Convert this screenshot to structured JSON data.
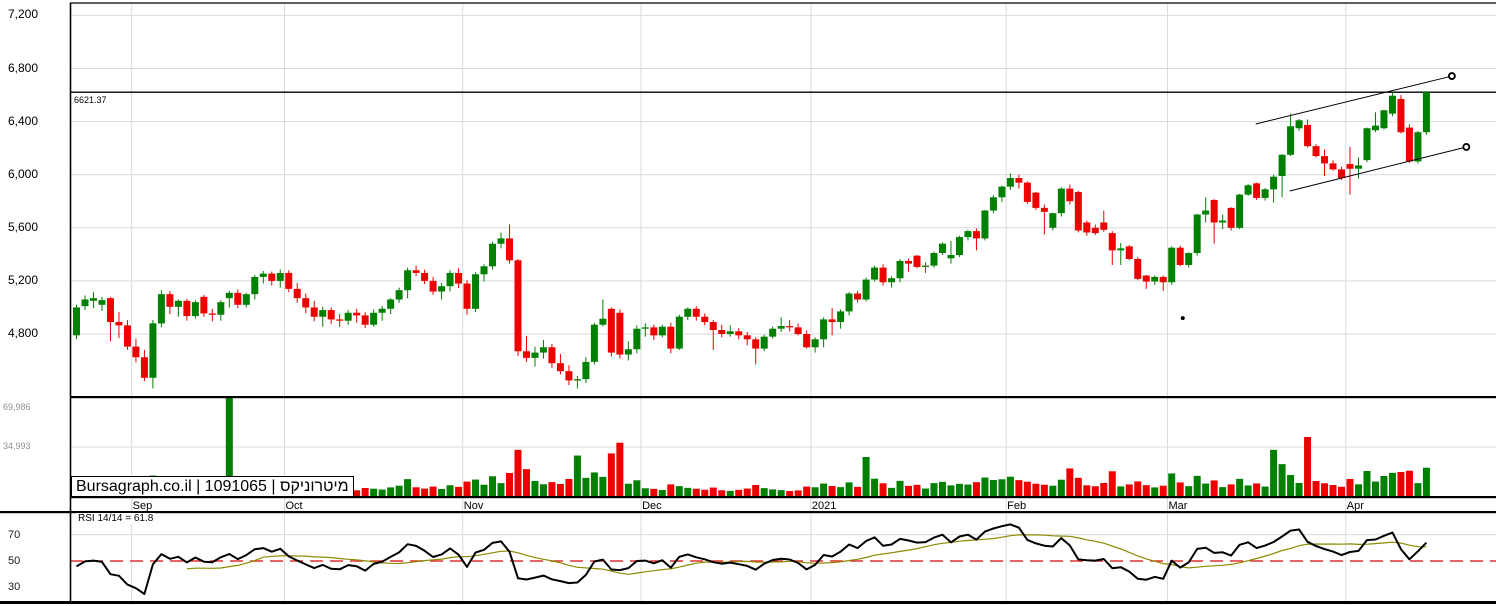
{
  "meta": {
    "source": "Bursagraph.co.il",
    "security_id": "1091065",
    "security_name": "מיטרוניקס",
    "watermark": "Bursagraph.co.il | 1091065 | מיטרוניקס"
  },
  "last_price": {
    "label": "6621.37",
    "value": 6621.37
  },
  "rsi_panel": {
    "label": "RSI 14/14 = 61.8",
    "period": 14,
    "smoothing": 14,
    "last_value": 61.8,
    "ticks": [
      {
        "label": "70",
        "value": 70,
        "gridline": "gray"
      },
      {
        "label": "50",
        "value": 50,
        "gridline": "dashed-red"
      },
      {
        "label": "30",
        "value": 30,
        "gridline": "none"
      }
    ]
  },
  "price_axis": {
    "ticks": [
      {
        "label": "7,200",
        "value": 7200
      },
      {
        "label": "6,800",
        "value": 6800
      },
      {
        "label": "6,400",
        "value": 6400
      },
      {
        "label": "6,000",
        "value": 6000
      },
      {
        "label": "5,600",
        "value": 5600
      },
      {
        "label": "5,200",
        "value": 5200
      },
      {
        "label": "4,800",
        "value": 4800
      }
    ]
  },
  "volume_axis": {
    "ticks": [
      {
        "label": "69,986",
        "value": 69986
      },
      {
        "label": "34,993",
        "value": 34993
      }
    ]
  },
  "colors": {
    "up": "#008000",
    "down": "#ee0000",
    "grid": "#d9d9d9",
    "border": "#000000",
    "rsi_line": "#000000",
    "rsi_signal": "#8a8a00",
    "rsi_midline": "#e03030",
    "last_price_line": "#000000",
    "volume_label": "#8f8f8f"
  },
  "chart_data": {
    "type": "candlestick",
    "panels": [
      "price",
      "volume",
      "rsi"
    ],
    "price_ylim": [
      4330,
      7290
    ],
    "volume_ylim": [
      0,
      69986
    ],
    "rsi_ylim": [
      15,
      88
    ],
    "grid": true,
    "months": [
      {
        "label": "Sep",
        "boundary_index": 7
      },
      {
        "label": "Oct",
        "boundary_index": 25
      },
      {
        "label": "Nov",
        "boundary_index": 46
      },
      {
        "label": "Dec",
        "boundary_index": 67
      },
      {
        "label": "2021",
        "boundary_index": 87
      },
      {
        "label": "Feb",
        "boundary_index": 110
      },
      {
        "label": "Mar",
        "boundary_index": 129
      },
      {
        "label": "Apr",
        "boundary_index": 150
      }
    ],
    "ohlcv_format": [
      "open",
      "high",
      "low",
      "close",
      "volume"
    ],
    "candles": [
      [
        4790,
        5020,
        4760,
        5000,
        9000
      ],
      [
        5010,
        5090,
        4980,
        5060,
        6000
      ],
      [
        5050,
        5115,
        4995,
        5070,
        5500
      ],
      [
        5020,
        5080,
        4975,
        5055,
        5000
      ],
      [
        5070,
        5080,
        4745,
        4890,
        12000
      ],
      [
        4890,
        4965,
        4770,
        4865,
        7000
      ],
      [
        4865,
        4905,
        4680,
        4705,
        9500
      ],
      [
        4705,
        4765,
        4585,
        4625,
        8000
      ],
      [
        4625,
        4680,
        4445,
        4470,
        10000
      ],
      [
        4470,
        4905,
        4390,
        4880,
        15000
      ],
      [
        4880,
        5130,
        4850,
        5100,
        11000
      ],
      [
        5100,
        5125,
        4950,
        5005,
        8500
      ],
      [
        5005,
        5060,
        4930,
        5050,
        5200
      ],
      [
        5050,
        5065,
        4900,
        4935,
        6800
      ],
      [
        4935,
        5055,
        4915,
        5040,
        6200
      ],
      [
        5080,
        5095,
        4930,
        4955,
        7400
      ],
      [
        4955,
        4990,
        4895,
        4945,
        4800
      ],
      [
        4945,
        5055,
        4900,
        5040,
        6600
      ],
      [
        5070,
        5125,
        5000,
        5110,
        69986
      ],
      [
        5110,
        5135,
        4995,
        5020,
        9800
      ],
      [
        5020,
        5110,
        5000,
        5100,
        7200
      ],
      [
        5100,
        5245,
        5060,
        5230,
        10500
      ],
      [
        5230,
        5275,
        5180,
        5255,
        6400
      ],
      [
        5255,
        5270,
        5165,
        5200,
        5600
      ],
      [
        5200,
        5285,
        5150,
        5260,
        7800
      ],
      [
        5260,
        5280,
        5115,
        5140,
        9200
      ],
      [
        5140,
        5185,
        5035,
        5070,
        7600
      ],
      [
        5070,
        5105,
        4955,
        5000,
        6900
      ],
      [
        5000,
        5050,
        4895,
        4930,
        8100
      ],
      [
        4930,
        5005,
        4855,
        4980,
        5400
      ],
      [
        4980,
        5000,
        4875,
        4910,
        4900
      ],
      [
        4910,
        4950,
        4855,
        4900,
        4300
      ],
      [
        4900,
        4980,
        4870,
        4960,
        5100
      ],
      [
        4960,
        4990,
        4885,
        4940,
        4700
      ],
      [
        4940,
        4965,
        4845,
        4870,
        6300
      ],
      [
        4870,
        4985,
        4855,
        4960,
        5800
      ],
      [
        4960,
        5010,
        4900,
        4990,
        5200
      ],
      [
        4990,
        5070,
        4950,
        5060,
        6700
      ],
      [
        5060,
        5150,
        5035,
        5130,
        7900
      ],
      [
        5130,
        5300,
        5070,
        5280,
        12500
      ],
      [
        5280,
        5315,
        5235,
        5260,
        6800
      ],
      [
        5260,
        5285,
        5175,
        5200,
        5900
      ],
      [
        5200,
        5230,
        5095,
        5120,
        7300
      ],
      [
        5120,
        5185,
        5060,
        5160,
        5600
      ],
      [
        5160,
        5280,
        5120,
        5260,
        8200
      ],
      [
        5260,
        5295,
        5145,
        5180,
        7100
      ],
      [
        5180,
        5205,
        4945,
        4990,
        10800
      ],
      [
        4990,
        5265,
        4965,
        5250,
        12200
      ],
      [
        5250,
        5325,
        5195,
        5310,
        8600
      ],
      [
        5310,
        5495,
        5285,
        5480,
        14500
      ],
      [
        5480,
        5565,
        5445,
        5520,
        9700
      ],
      [
        5520,
        5625,
        5330,
        5355,
        16800
      ],
      [
        5355,
        5365,
        4635,
        4670,
        33000
      ],
      [
        4670,
        4785,
        4590,
        4620,
        19500
      ],
      [
        4620,
        4705,
        4555,
        4660,
        11200
      ],
      [
        4660,
        4755,
        4615,
        4700,
        8900
      ],
      [
        4700,
        4725,
        4545,
        4580,
        10400
      ],
      [
        4580,
        4650,
        4495,
        4520,
        9100
      ],
      [
        4520,
        4565,
        4415,
        4450,
        12600
      ],
      [
        4450,
        4485,
        4390,
        4460,
        29000
      ],
      [
        4460,
        4625,
        4430,
        4590,
        13400
      ],
      [
        4590,
        4885,
        4570,
        4870,
        17200
      ],
      [
        4870,
        5060,
        4855,
        4915,
        14100
      ],
      [
        4990,
        5000,
        4630,
        4660,
        30500
      ],
      [
        4960,
        4985,
        4615,
        4645,
        38000
      ],
      [
        4645,
        4745,
        4600,
        4685,
        9300
      ],
      [
        4685,
        4865,
        4655,
        4840,
        11700
      ],
      [
        4840,
        4880,
        4780,
        4850,
        6100
      ],
      [
        4850,
        4870,
        4755,
        4790,
        5700
      ],
      [
        4790,
        4870,
        4775,
        4855,
        4900
      ],
      [
        4855,
        4885,
        4655,
        4690,
        8800
      ],
      [
        4690,
        4945,
        4680,
        4930,
        7600
      ],
      [
        4930,
        5000,
        4905,
        4990,
        6400
      ],
      [
        4990,
        5010,
        4900,
        4930,
        5800
      ],
      [
        4930,
        4955,
        4865,
        4890,
        5100
      ],
      [
        4890,
        4905,
        4680,
        4830,
        6600
      ],
      [
        4830,
        4870,
        4775,
        4800,
        4700
      ],
      [
        4800,
        4865,
        4780,
        4820,
        4300
      ],
      [
        4820,
        4845,
        4760,
        4790,
        5000
      ],
      [
        4790,
        4815,
        4715,
        4760,
        5900
      ],
      [
        4760,
        4775,
        4570,
        4690,
        8400
      ],
      [
        4690,
        4795,
        4670,
        4780,
        6200
      ],
      [
        4780,
        4855,
        4765,
        4840,
        5300
      ],
      [
        4840,
        4925,
        4815,
        4860,
        4800
      ],
      [
        4860,
        4905,
        4820,
        4850,
        4200
      ],
      [
        4850,
        4880,
        4790,
        4800,
        4600
      ],
      [
        4800,
        4825,
        4690,
        4700,
        7300
      ],
      [
        4700,
        4775,
        4660,
        4760,
        6800
      ],
      [
        4760,
        4925,
        4700,
        4910,
        9400
      ],
      [
        4910,
        4995,
        4790,
        4890,
        7700
      ],
      [
        4890,
        4985,
        4840,
        4970,
        6900
      ],
      [
        4970,
        5115,
        4940,
        5105,
        10200
      ],
      [
        5105,
        5125,
        5035,
        5060,
        7100
      ],
      [
        5060,
        5225,
        5045,
        5210,
        28000
      ],
      [
        5210,
        5315,
        5195,
        5300,
        12800
      ],
      [
        5300,
        5325,
        5165,
        5190,
        9600
      ],
      [
        5190,
        5235,
        5150,
        5220,
        6400
      ],
      [
        5220,
        5365,
        5190,
        5350,
        11300
      ],
      [
        5350,
        5370,
        5270,
        5330,
        7800
      ],
      [
        5390,
        5395,
        5295,
        5305,
        8500
      ],
      [
        5305,
        5340,
        5260,
        5315,
        5900
      ],
      [
        5315,
        5420,
        5300,
        5410,
        9700
      ],
      [
        5410,
        5490,
        5395,
        5480,
        10600
      ],
      [
        5370,
        5500,
        5330,
        5395,
        8100
      ],
      [
        5395,
        5540,
        5380,
        5530,
        9200
      ],
      [
        5530,
        5585,
        5505,
        5575,
        8700
      ],
      [
        5575,
        5595,
        5430,
        5520,
        10400
      ],
      [
        5520,
        5735,
        5505,
        5730,
        13600
      ],
      [
        5730,
        5845,
        5710,
        5830,
        11900
      ],
      [
        5830,
        5920,
        5795,
        5910,
        12400
      ],
      [
        5910,
        6010,
        5885,
        5975,
        14200
      ],
      [
        5975,
        6000,
        5895,
        5940,
        11800
      ],
      [
        5940,
        5950,
        5780,
        5795,
        10700
      ],
      [
        5865,
        5870,
        5735,
        5750,
        9300
      ],
      [
        5750,
        5775,
        5550,
        5720,
        8600
      ],
      [
        5600,
        5715,
        5580,
        5710,
        7900
      ],
      [
        5710,
        5905,
        5685,
        5895,
        12100
      ],
      [
        5895,
        5925,
        5775,
        5800,
        20000
      ],
      [
        5870,
        5880,
        5565,
        5580,
        13400
      ],
      [
        5640,
        5655,
        5540,
        5565,
        8200
      ],
      [
        5600,
        5625,
        5545,
        5560,
        7500
      ],
      [
        5640,
        5730,
        5570,
        5585,
        9800
      ],
      [
        5560,
        5575,
        5320,
        5430,
        18000
      ],
      [
        5430,
        5485,
        5320,
        5445,
        7400
      ],
      [
        5460,
        5470,
        5355,
        5365,
        8800
      ],
      [
        5365,
        5380,
        5205,
        5215,
        10900
      ],
      [
        5240,
        5245,
        5140,
        5195,
        8300
      ],
      [
        5195,
        5240,
        5170,
        5230,
        6700
      ],
      [
        5230,
        5240,
        5125,
        5190,
        7900
      ],
      [
        5190,
        5460,
        5170,
        5450,
        16500
      ],
      [
        5450,
        5465,
        5310,
        5320,
        10200
      ],
      [
        5320,
        5415,
        5300,
        5410,
        7600
      ],
      [
        5410,
        5705,
        5390,
        5700,
        14800
      ],
      [
        5700,
        5830,
        5640,
        5730,
        9400
      ],
      [
        5810,
        5815,
        5480,
        5640,
        11600
      ],
      [
        5640,
        5700,
        5590,
        5655,
        6900
      ],
      [
        5750,
        5755,
        5580,
        5600,
        8800
      ],
      [
        5600,
        5855,
        5590,
        5850,
        12700
      ],
      [
        5850,
        5930,
        5840,
        5920,
        8100
      ],
      [
        5935,
        5940,
        5810,
        5825,
        9500
      ],
      [
        5825,
        5900,
        5805,
        5890,
        7300
      ],
      [
        5890,
        6000,
        5790,
        5985,
        33000
      ],
      [
        5990,
        6155,
        5830,
        6150,
        23000
      ],
      [
        6150,
        6460,
        6140,
        6365,
        15400
      ],
      [
        6350,
        6420,
        6330,
        6410,
        9800
      ],
      [
        6375,
        6415,
        6205,
        6215,
        42000
      ],
      [
        6215,
        6230,
        6130,
        6140,
        11200
      ],
      [
        6140,
        6190,
        5990,
        6085,
        9600
      ],
      [
        6085,
        6110,
        6030,
        6040,
        8400
      ],
      [
        6040,
        6060,
        5960,
        5975,
        7200
      ],
      [
        6080,
        6210,
        5850,
        6045,
        12600
      ],
      [
        6045,
        6130,
        5970,
        6070,
        8900
      ],
      [
        6110,
        6355,
        6095,
        6350,
        18200
      ],
      [
        6335,
        6470,
        6320,
        6370,
        10800
      ],
      [
        6350,
        6490,
        6340,
        6485,
        14700
      ],
      [
        6460,
        6620,
        6440,
        6595,
        16900
      ],
      [
        6570,
        6600,
        6310,
        6320,
        17500
      ],
      [
        6355,
        6380,
        6090,
        6100,
        18400
      ],
      [
        6100,
        6330,
        6085,
        6320,
        9700
      ],
      [
        6320,
        6630,
        6300,
        6621.37,
        20500
      ]
    ],
    "annotations": {
      "last_price_line": 6621.37,
      "trend_channel": {
        "upper": {
          "from": {
            "index": 138.9,
            "price": 6382
          },
          "to": {
            "index": 162.0,
            "price": 6743
          },
          "end_marker": "circle"
        },
        "lower": {
          "from": {
            "index": 142.9,
            "price": 5877
          },
          "to": {
            "index": 163.7,
            "price": 6209
          },
          "end_marker": "circle"
        }
      },
      "dot": {
        "index": 130.3,
        "price": 4920
      }
    }
  }
}
